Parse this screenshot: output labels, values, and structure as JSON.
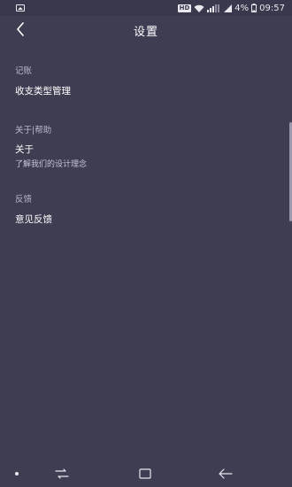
{
  "status_bar": {
    "hd": "HD",
    "battery_percent": "4%",
    "time": "09:57"
  },
  "header": {
    "title": "设置"
  },
  "sections": {
    "bookkeeping": {
      "header": "记账",
      "items": [
        {
          "title": "收支类型管理"
        }
      ]
    },
    "about_help": {
      "header": "关于|帮助",
      "items": [
        {
          "title": "关于",
          "subtitle": "了解我们的设计理念"
        }
      ]
    },
    "feedback": {
      "header": "反馈",
      "items": [
        {
          "title": "意见反馈"
        }
      ]
    }
  },
  "colors": {
    "background": "#3f3d52",
    "text_primary": "#ffffff",
    "text_secondary": "#b9b7c8"
  },
  "icons": [
    "gallery-icon",
    "wifi-icon",
    "signal-icon",
    "battery-icon",
    "back-arrow-icon",
    "recent-apps-icon",
    "home-icon",
    "back-nav-icon"
  ]
}
